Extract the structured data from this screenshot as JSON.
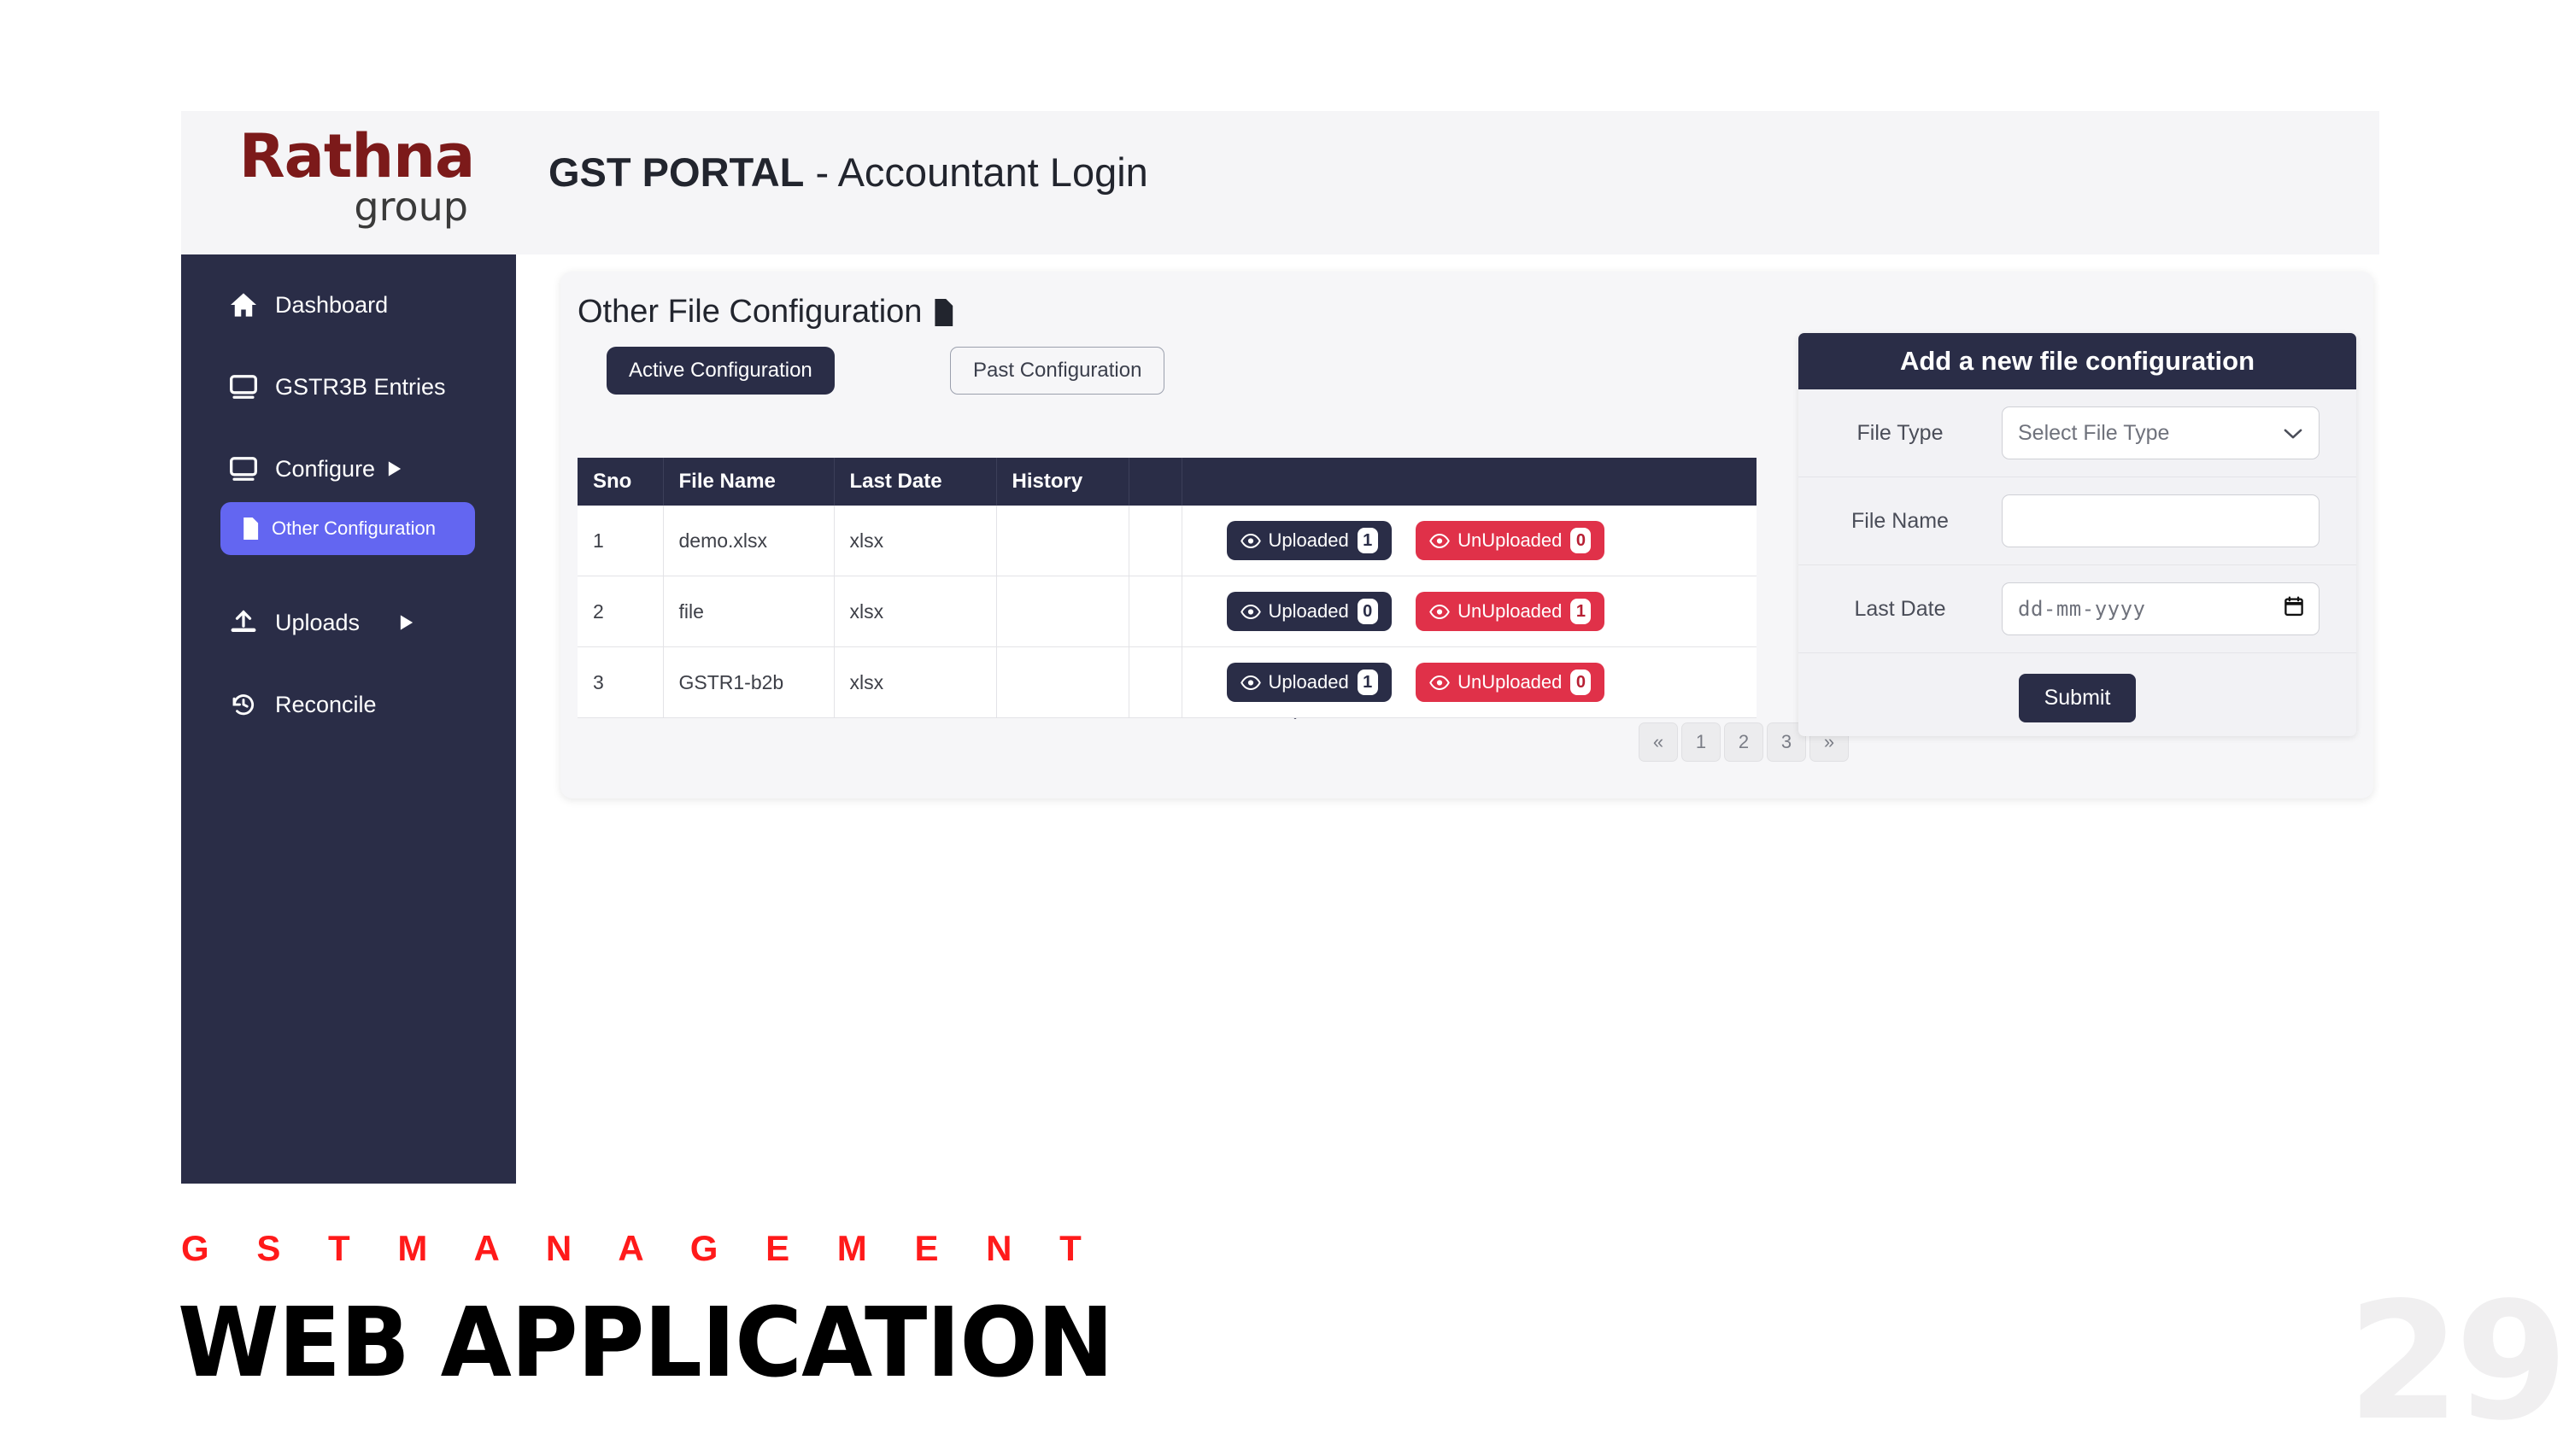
{
  "slide": {
    "kicker": "G S T   M A N A G E M E N T",
    "headline": "WEB APPLICATION",
    "page_number": "29"
  },
  "header": {
    "logo_word": "Rathna",
    "logo_sub": "group",
    "title_bold": "GST PORTAL",
    "title_rest": " - Accountant Login",
    "logo_color": "#7c1a1a",
    "background": "#f5f5f7"
  },
  "sidebar": {
    "background": "#2a2d47",
    "active_color": "#6366f1",
    "items": [
      {
        "label": "Dashboard",
        "icon": "home-icon",
        "caret": ""
      },
      {
        "label": "GSTR3B Entries",
        "icon": "monitor-icon",
        "caret": ""
      },
      {
        "label": "Configure",
        "icon": "monitor-icon",
        "caret": "▶"
      },
      {
        "label": "Uploads",
        "icon": "upload-icon",
        "caret": "▶"
      },
      {
        "label": "Reconcile",
        "icon": "history-icon",
        "caret": ""
      }
    ],
    "sub_item": {
      "label": "Other Configuration",
      "icon": "file-icon"
    }
  },
  "main": {
    "card_title": "Other File Configuration",
    "card_title_icon": "file-icon",
    "tabs": [
      {
        "label": "Active Configuration",
        "state": "active"
      },
      {
        "label": "Past Configuration",
        "state": "inactive"
      }
    ],
    "tab_indicator_icon": "arrow-down-icon",
    "table": {
      "columns": [
        "Sno",
        "File Name",
        "Last Date",
        "History",
        "",
        ""
      ],
      "rows": [
        {
          "sno": "1",
          "file_name": "demo.xlsx",
          "last_date": "xlsx",
          "history": "",
          "uploaded_label": "Uploaded",
          "uploaded_count": "1",
          "unuploaded_label": "UnUploaded",
          "unuploaded_count": "0"
        },
        {
          "sno": "2",
          "file_name": "file",
          "last_date": "xlsx",
          "history": "",
          "uploaded_label": "Uploaded",
          "uploaded_count": "0",
          "unuploaded_label": "UnUploaded",
          "unuploaded_count": "1"
        },
        {
          "sno": "3",
          "file_name": "GSTR1-b2b",
          "last_date": "xlsx",
          "history": "",
          "uploaded_label": "Uploaded",
          "uploaded_count": "1",
          "unuploaded_label": "UnUploaded",
          "unuploaded_count": "0"
        }
      ]
    },
    "pagination": {
      "prev": "«",
      "pages": [
        "1",
        "2",
        "3"
      ],
      "next": "»"
    }
  },
  "form": {
    "title": "Add a new file configuration",
    "file_type_label": "File Type",
    "file_type_value": "Select File Type",
    "file_name_label": "File Name",
    "file_name_value": "",
    "last_date_label": "Last Date",
    "last_date_placeholder": "dd-mm-yyyy",
    "submit_label": "Submit"
  },
  "colors": {
    "navy": "#2a2d47",
    "danger": "#e03149",
    "indigo": "#6366f1"
  }
}
